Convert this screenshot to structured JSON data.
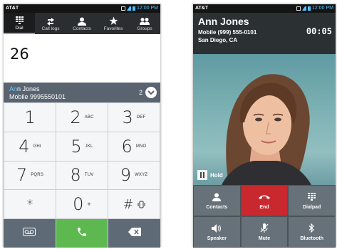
{
  "dialer": {
    "status": {
      "carrier": "AT&T",
      "time": "12:00 PM"
    },
    "tabs": [
      {
        "label": "Dial",
        "icon": "dialpad-icon"
      },
      {
        "label": "Call logs",
        "icon": "call-logs-icon"
      },
      {
        "label": "Contacts",
        "icon": "person-icon"
      },
      {
        "label": "Favorites",
        "icon": "star-icon"
      },
      {
        "label": "Groups",
        "icon": "group-icon"
      }
    ],
    "active_tab": "Dial",
    "entered_number": "26",
    "suggestion": {
      "name_highlight": "An",
      "name_rest": "n Jones",
      "number": "Mobile 9995550101",
      "count": "2"
    },
    "keys": [
      {
        "digit": "1",
        "letters": ""
      },
      {
        "digit": "2",
        "letters": "ABC"
      },
      {
        "digit": "3",
        "letters": "DEF"
      },
      {
        "digit": "4",
        "letters": "GHI"
      },
      {
        "digit": "5",
        "letters": "JKL"
      },
      {
        "digit": "6",
        "letters": "MNO"
      },
      {
        "digit": "7",
        "letters": "PQRS"
      },
      {
        "digit": "8",
        "letters": "TUV"
      },
      {
        "digit": "9",
        "letters": "WXYZ"
      },
      {
        "digit": "*",
        "letters": ""
      },
      {
        "digit": "0",
        "letters": "+"
      },
      {
        "digit": "#",
        "letters": ""
      }
    ],
    "bottom": {
      "voicemail_icon": "voicemail-icon",
      "call_icon": "phone-icon",
      "delete_icon": "backspace-icon"
    },
    "colors": {
      "call": "#5cb84f",
      "tabbar": "#2b2e31",
      "highlight": "#65c8ff"
    }
  },
  "incall": {
    "status": {
      "carrier": "AT&T",
      "time": "12:00 PM"
    },
    "caller": {
      "name": "Ann Jones",
      "number": "Mobile (999) 555-0101",
      "location": "San Diego, CA"
    },
    "timer": "00:05",
    "hold_label": "Hold",
    "actions": [
      {
        "label": "Contacts",
        "icon": "person-icon"
      },
      {
        "label": "End",
        "icon": "end-call-icon"
      },
      {
        "label": "Dialpad",
        "icon": "dialpad-icon"
      },
      {
        "label": "Speaker",
        "icon": "speaker-icon"
      },
      {
        "label": "Mute",
        "icon": "mute-icon"
      },
      {
        "label": "Bluetooth",
        "icon": "bluetooth-icon"
      }
    ],
    "colors": {
      "end": "#c8282e",
      "button": "#66717a"
    }
  }
}
